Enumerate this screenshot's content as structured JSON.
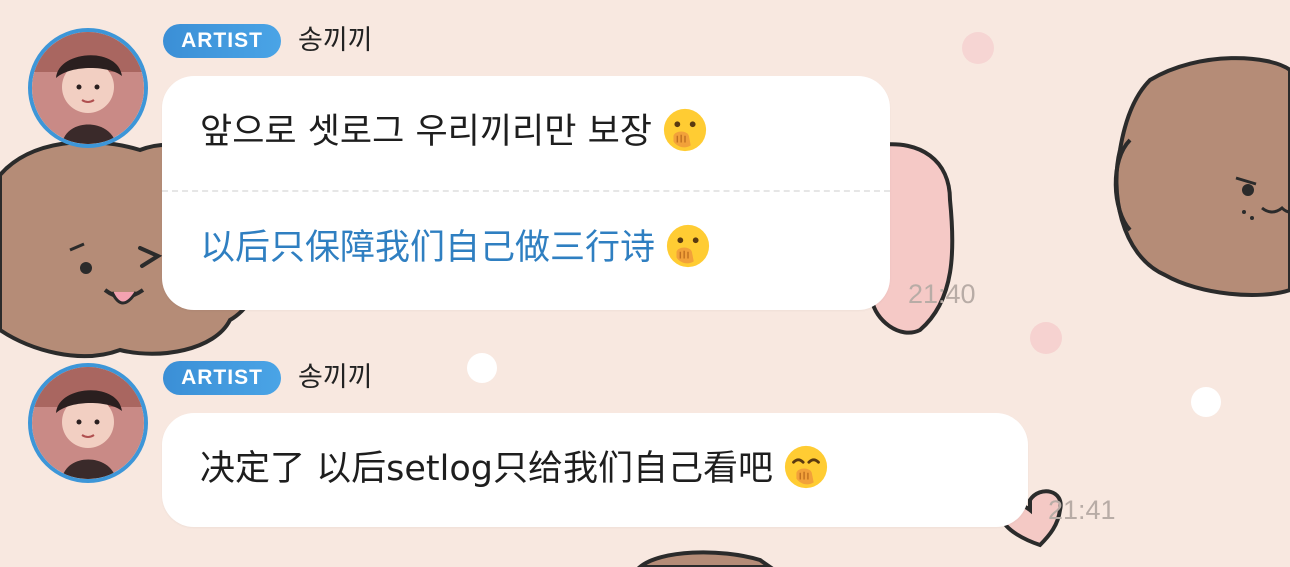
{
  "colors": {
    "background": "#f8e8e0",
    "accent": "#3d96d8",
    "translation_text": "#2f7fc1",
    "bubble": "#ffffff",
    "timestamp": "#b8aca6"
  },
  "messages": [
    {
      "badge": "ARTIST",
      "sender": "송끼끼",
      "text": "앞으로 셋로그 우리끼리만 보장",
      "translation": "以后只保障我们自己做三行诗",
      "emoji": "face-with-hand-over-mouth-icon",
      "time": "21:40"
    },
    {
      "badge": "ARTIST",
      "sender": "송끼끼",
      "text": "决定了 以后setlog只给我们自己看吧",
      "emoji": "hugging-face-icon",
      "time": "21:41"
    }
  ]
}
